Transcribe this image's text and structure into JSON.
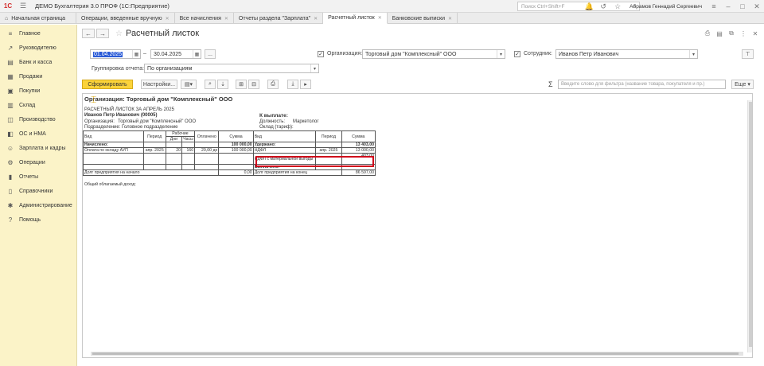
{
  "app": {
    "title": "ДЕМО Бухгалтерия 3.0 ПРОФ  (1С:Предприятие)",
    "search_placeholder": "Поиск Ctrl+Shift+F",
    "user": "Абрамов Геннадий Сергеевич"
  },
  "tabs": [
    {
      "label": "Начальная страница"
    },
    {
      "label": "Операции, введенные вручную"
    },
    {
      "label": "Все начисления"
    },
    {
      "label": "Отчеты раздела \"Зарплата\""
    },
    {
      "label": "Расчетный листок"
    },
    {
      "label": "Банковские выписки"
    }
  ],
  "sidebar": {
    "items": [
      {
        "label": "Главное",
        "icon": "menu-icon"
      },
      {
        "label": "Руководителю",
        "icon": "chart-icon"
      },
      {
        "label": "Банк и касса",
        "icon": "bank-icon"
      },
      {
        "label": "Продажи",
        "icon": "cart-icon"
      },
      {
        "label": "Покупки",
        "icon": "basket-icon"
      },
      {
        "label": "Склад",
        "icon": "warehouse-icon"
      },
      {
        "label": "Производство",
        "icon": "factory-icon"
      },
      {
        "label": "ОС и НМА",
        "icon": "building-icon"
      },
      {
        "label": "Зарплата и кадры",
        "icon": "people-icon"
      },
      {
        "label": "Операции",
        "icon": "operations-icon"
      },
      {
        "label": "Отчеты",
        "icon": "report-icon"
      },
      {
        "label": "Справочники",
        "icon": "book-icon"
      },
      {
        "label": "Администрирование",
        "icon": "gear-icon"
      },
      {
        "label": "Помощь",
        "icon": "help-icon"
      }
    ]
  },
  "doc": {
    "title": "Расчетный листок",
    "date_from": "01.04.2025",
    "date_to": "30.04.2025",
    "dots": "...",
    "org_label": "Организация:",
    "org_value": "Торговый дом \"Комплексный\" ООО",
    "emp_label": "Сотрудник:",
    "emp_value": "Иванов Петр Иванович",
    "group_label": "Группировка отчета:",
    "group_value": "По организациям"
  },
  "toolbar": {
    "generate": "Сформировать",
    "settings": "Настройки...",
    "filter_placeholder": "Введите слово для фильтра (название товара, покупателя и пр.)",
    "more": "Еще"
  },
  "report": {
    "org_heading": "Организация: Торговый дом \"Комплексный\" ООО",
    "sheet_title": "РАСЧЕТНЫЙ ЛИСТОК ЗА АПРЕЛЬ 2025",
    "employee": "Иванов Петр Иванович (00005)",
    "org_line_label": "Организация:",
    "org_line_value": "Торговый дом \"Комплексный\" ООО",
    "dept_line": "Подразделение: Головное подразделение",
    "to_pay": "К выплате:",
    "position_label": "Должность:",
    "position_value": "Маркетолог",
    "salary_label": "Оклад (тариф):",
    "left_headers": {
      "kind": "Вид",
      "period": "Период",
      "worked": "Рабочие",
      "days": "Дни",
      "hours": "Часы",
      "paid": "Оплачено",
      "sum": "Сумма"
    },
    "right_headers": {
      "kind": "Вид",
      "period": "Период",
      "sum": "Сумма"
    },
    "accrued_label": "Начислено:",
    "accrued_sum": "100 000,00",
    "accrual_row": {
      "kind": "Оплата по окладу АУП",
      "period": "апр. 2025",
      "days": "20",
      "hours": "160",
      "paid": "20,00 дн",
      "sum": "100 000,00"
    },
    "withheld_label": "Удержано:",
    "withheld_sum": "13 403,00",
    "ndfl_row": {
      "kind": "НДФЛ",
      "period": "апр. 2025",
      "sum": "13 000,00"
    },
    "ndfl_mat_row": {
      "kind": "НДФЛ с материальной выгоды",
      "sum": "403,00"
    },
    "paid_out_label": "Выплачено:",
    "debt_start_label": "Долг предприятия на начало",
    "debt_start_value": "0,00",
    "debt_end_label": "Долг предприятия на конец",
    "debt_end_value": "86 597,00",
    "taxable_income": "Общий облагаемый доход:"
  },
  "colors": {
    "accent": "#fbd33a",
    "sidebar_bg": "#fbf3c8",
    "highlight": "#d0021b"
  }
}
